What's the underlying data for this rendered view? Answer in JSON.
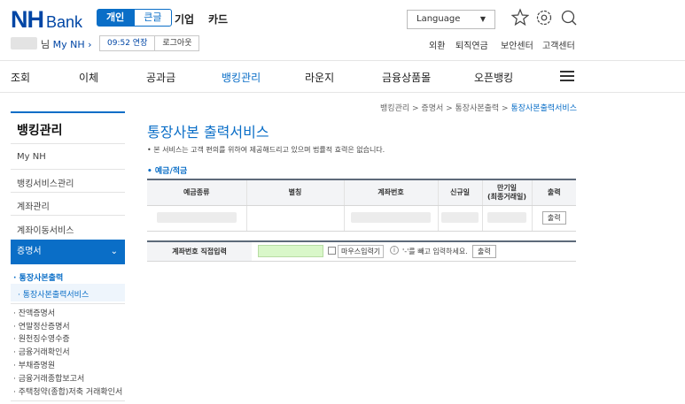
{
  "header": {
    "logo_nh": "NH",
    "logo_bank": "Bank",
    "seg_personal": "개인",
    "seg_large": "큰글",
    "cat_corporate": "기업",
    "cat_card": "카드",
    "language": "Language"
  },
  "user": {
    "suffix": "님",
    "my_nh": "My NH ›",
    "session_time": "09:52 연장",
    "logout": "로그아웃"
  },
  "util": [
    "외환",
    "퇴직연금",
    "보안센터",
    "고객센터"
  ],
  "nav": [
    "조회",
    "이체",
    "공과금",
    "뱅킹관리",
    "라운지",
    "금융상품몰",
    "오픈뱅킹"
  ],
  "nav_active_color": "#0a6ec7",
  "sidebar": {
    "title": "뱅킹관리",
    "items": [
      "My NH",
      "뱅킹서비스관리",
      "계좌관리",
      "계좌이동서비스"
    ],
    "active": "증명서",
    "sub1": "· 통장사본출력",
    "sub2": "· 통장사본출력서비스",
    "small_items": [
      "· 잔액증명서",
      "· 연말정산증명서",
      "· 원천징수영수증",
      "· 금융거래확인서",
      "· 부채증명원",
      "· 금융거래종합보고서",
      "· 주택청약(종합)저축 거래확인서"
    ]
  },
  "breadcrumb": {
    "path": "뱅킹관리 > 증명서 > 통장사본출력 > ",
    "current": "통장사본출력서비스"
  },
  "content": {
    "title": "통장사본 출력서비스",
    "notice": "• 본 서비스는 고객 편의를 위하여 제공해드리고 있으며 법률적 효력은 없습니다.",
    "section": "• 예금/적금",
    "table_headers": [
      "예금종류",
      "별칭",
      "계좌번호",
      "신규일",
      "만기일\n(최종거래일)",
      "출력"
    ],
    "row_print": "출력",
    "direct_label": "계좌번호 직접입력",
    "mouse_input": "마우스입력기",
    "info_icon": "i",
    "hint": "'-'를 빼고 입력하세요.",
    "direct_print": "출력"
  }
}
